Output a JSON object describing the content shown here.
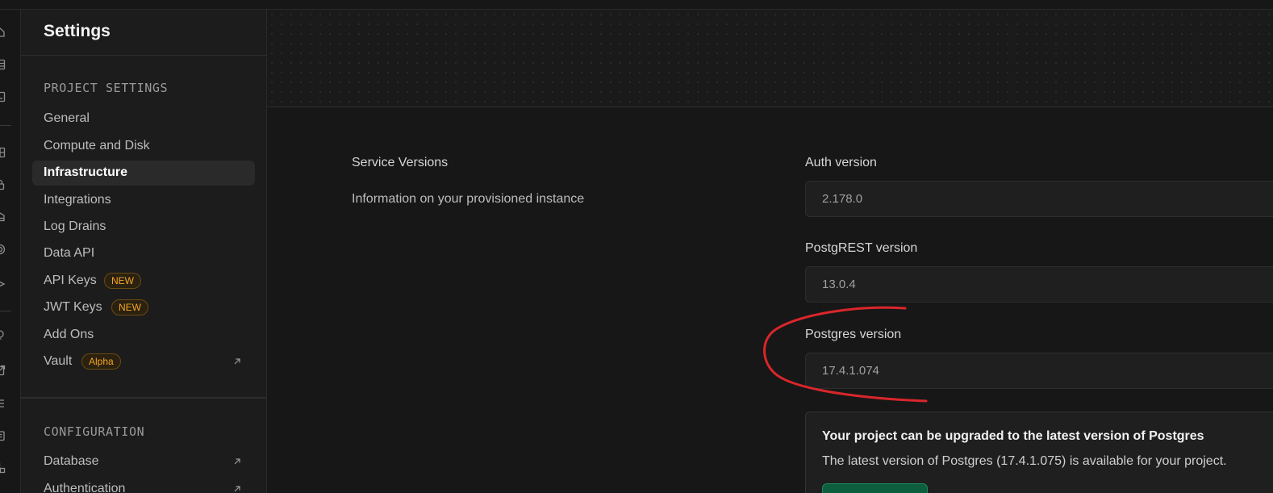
{
  "sidebar": {
    "title": "Settings",
    "project_section": "PROJECT SETTINGS",
    "items": [
      {
        "label": "General"
      },
      {
        "label": "Compute and Disk"
      },
      {
        "label": "Infrastructure",
        "active": true
      },
      {
        "label": "Integrations"
      },
      {
        "label": "Log Drains"
      },
      {
        "label": "Data API"
      },
      {
        "label": "API Keys",
        "badge": "NEW"
      },
      {
        "label": "JWT Keys",
        "badge": "NEW"
      },
      {
        "label": "Add Ons"
      },
      {
        "label": "Vault",
        "badge": "Alpha",
        "external": true
      }
    ],
    "config_section": "CONFIGURATION",
    "config_items": [
      {
        "label": "Database",
        "external": true
      },
      {
        "label": "Authentication",
        "external": true
      }
    ]
  },
  "main": {
    "section_title": "Service Versions",
    "section_description": "Information on your provisioned instance",
    "fields": [
      {
        "label": "Auth version",
        "value": "2.178.0"
      },
      {
        "label": "PostgREST version",
        "value": "13.0.4"
      },
      {
        "label": "Postgres version",
        "value": "17.4.1.074"
      }
    ],
    "upgrade_notice": {
      "title": "Your project can be upgraded to the latest version of Postgres",
      "body": "The latest version of Postgres (17.4.1.075) is available for your project."
    }
  },
  "colors": {
    "accent_badge": "#f5a524",
    "button_green": "#0d5e3f",
    "annotation_red": "#d9262b"
  },
  "icons": {
    "rail": [
      "home-icon",
      "table-editor-icon",
      "sql-editor-icon",
      "database-icon",
      "auth-icon",
      "storage-icon",
      "edge-functions-icon",
      "realtime-icon",
      "advisors-icon",
      "reports-icon",
      "logs-icon",
      "api-docs-icon",
      "integrations-icon"
    ],
    "external": "external-link-icon"
  }
}
